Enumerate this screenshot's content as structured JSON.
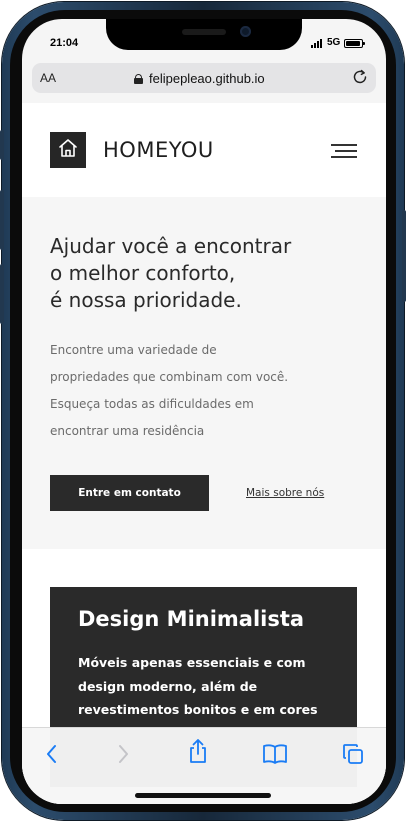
{
  "status_bar": {
    "time": "21:04",
    "network": "5G",
    "battery_level": 0.9
  },
  "browser": {
    "text_size_label": "AA",
    "url": "felipepleao.github.io"
  },
  "site": {
    "brand": "HOMEYOU",
    "hero": {
      "title_lines": [
        "Ajudar você a encontrar",
        "o melhor conforto,",
        "é nossa prioridade."
      ],
      "description_lines": [
        "Encontre uma variedade de",
        "propriedades que combinam com você.",
        "Esqueça todas as dificuldades em",
        "encontrar uma residência"
      ],
      "cta_label": "Entre em contato",
      "link_label": "Mais sobre nós"
    },
    "feature_card": {
      "title": "Design Minimalista",
      "text_lines": [
        "Móveis apenas essenciais e com",
        "design moderno, além de",
        "revestimentos bonitos e em cores"
      ]
    }
  },
  "icons": {
    "logo": "house-icon",
    "menu": "hamburger-icon",
    "back": "chevron-left-icon",
    "forward": "chevron-right-icon",
    "share": "share-icon",
    "bookmarks": "book-icon",
    "tabs": "tabs-icon",
    "reload": "reload-icon",
    "lock": "lock-icon"
  },
  "colors": {
    "accent_blue": "#1a7cf5",
    "dark": "#2a2a2a",
    "hero_bg": "#f6f6f6"
  }
}
